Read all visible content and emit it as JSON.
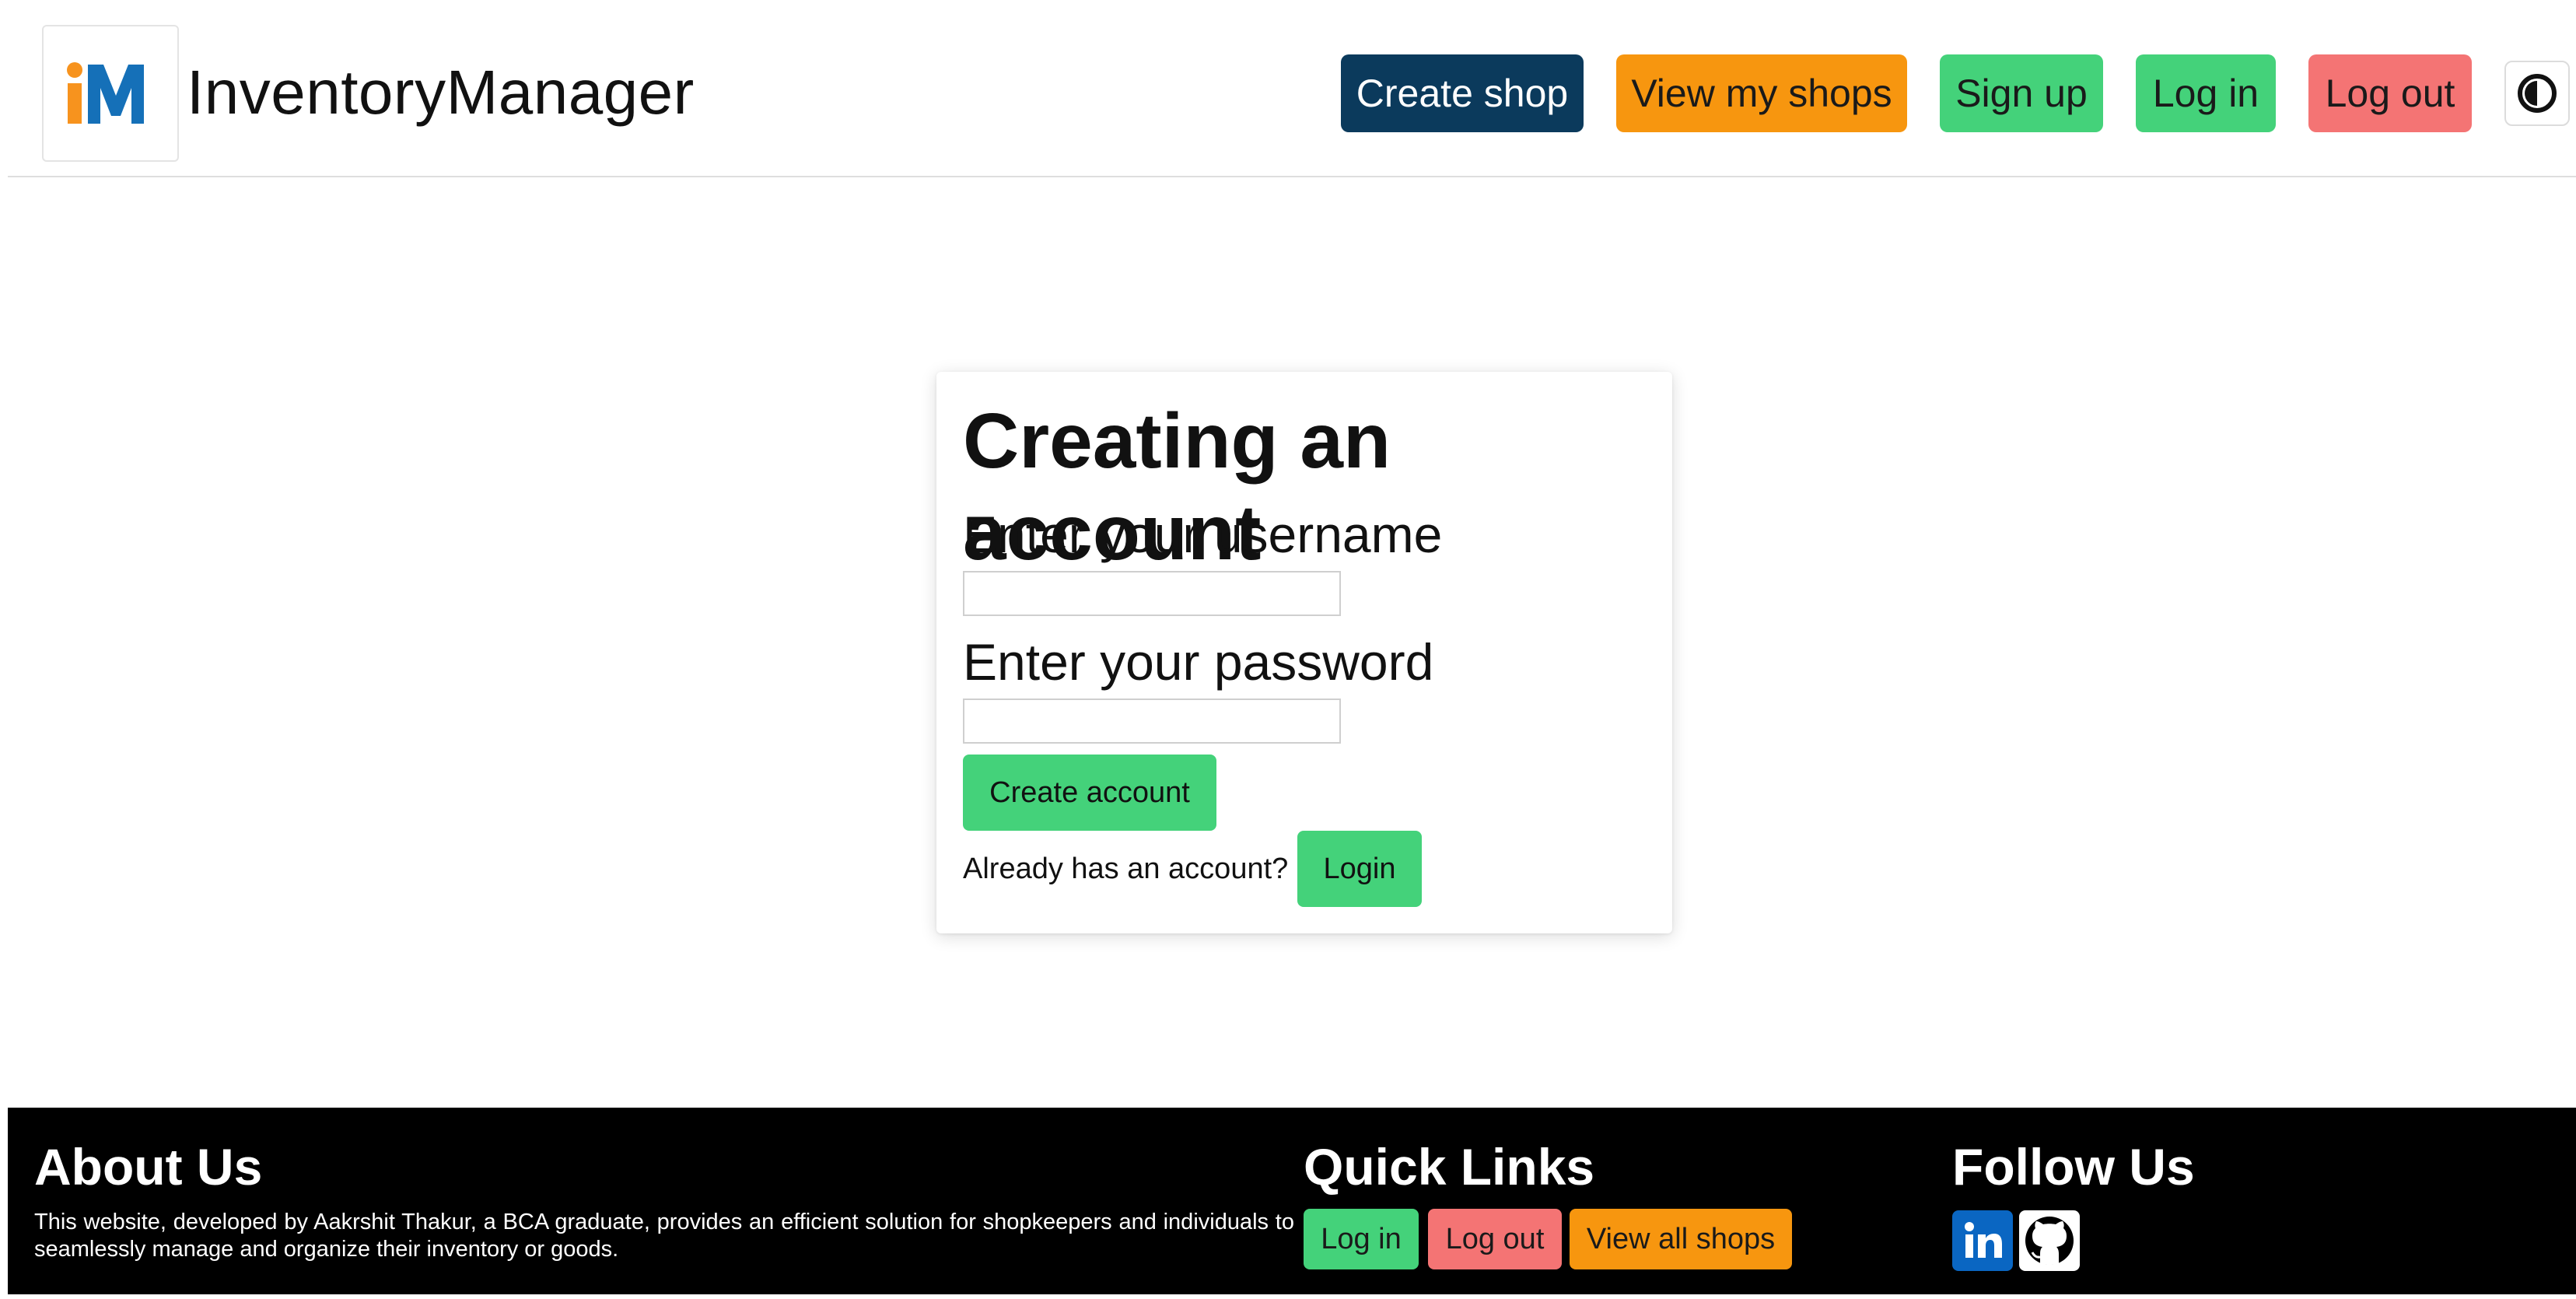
{
  "header": {
    "logo_text": "iM",
    "brand": "InventoryManager",
    "nav": {
      "create_shop": "Create shop",
      "view_my_shops": "View my shops",
      "sign_up": "Sign up",
      "log_in": "Log in",
      "log_out": "Log out"
    },
    "theme_toggle_icon": "contrast-icon"
  },
  "card": {
    "title": "Creating an account",
    "username_label": "Enter your username",
    "username_value": "",
    "password_label": "Enter your password",
    "password_value": "",
    "create_button": "Create account",
    "already_text": "Already has an account?",
    "login_button": "Login"
  },
  "footer": {
    "about_heading": "About Us",
    "about_text": "This website, developed by Aakrshit Thakur, a BCA graduate, provides an efficient solution for shopkeepers and individuals to seamlessly manage and organize their inventory or goods.",
    "quick_heading": "Quick Links",
    "quick_links": {
      "log_in": "Log in",
      "log_out": "Log out",
      "view_all_shops": "View all shops"
    },
    "follow_heading": "Follow Us",
    "social_icons": [
      "linkedin-icon",
      "github-icon"
    ]
  },
  "colors": {
    "navy": "#0b3a5c",
    "orange": "#f7960f",
    "green": "#44d27a",
    "red": "#f47474",
    "logo_orange": "#f7931e",
    "logo_blue": "#1570b8"
  }
}
